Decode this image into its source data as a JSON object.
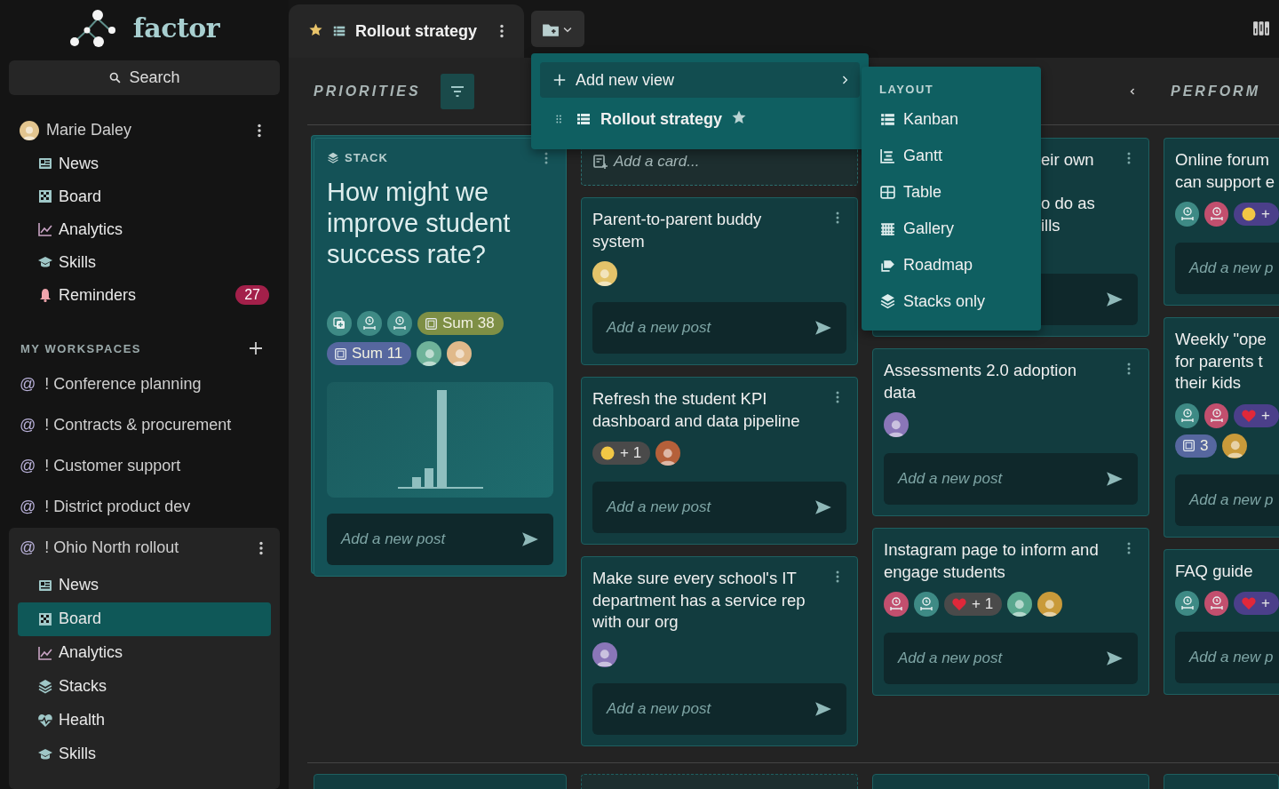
{
  "logo": {
    "text": "factor"
  },
  "search": {
    "placeholder": "Search"
  },
  "user": {
    "name": "Marie Daley",
    "items": [
      {
        "label": "News",
        "selected": false
      },
      {
        "label": "Board",
        "selected": false
      },
      {
        "label": "Analytics",
        "selected": false
      },
      {
        "label": "Skills",
        "selected": false
      },
      {
        "label": "Reminders",
        "selected": false,
        "badge": "27"
      }
    ]
  },
  "workspaces": {
    "title": "MY WORKSPACES",
    "items": [
      {
        "prefix": "@",
        "label": "! Conference planning",
        "expanded": false
      },
      {
        "prefix": "@",
        "label": "! Contracts & procurement",
        "expanded": false
      },
      {
        "prefix": "@",
        "label": "! Customer support",
        "expanded": false
      },
      {
        "prefix": "@",
        "label": "! District product dev",
        "expanded": false
      },
      {
        "prefix": "@",
        "label": "! Ohio North rollout",
        "expanded": true,
        "children": [
          {
            "label": "News",
            "selected": false
          },
          {
            "label": "Board",
            "selected": true
          },
          {
            "label": "Analytics",
            "selected": false
          },
          {
            "label": "Stacks",
            "selected": false
          },
          {
            "label": "Health",
            "selected": false
          },
          {
            "label": "Skills",
            "selected": false
          }
        ]
      }
    ]
  },
  "tab": {
    "title": "Rollout strategy",
    "starred": true
  },
  "board": {
    "groups": [
      {
        "label": "PRIORITIES"
      },
      {
        "label": "PERFORM"
      }
    ],
    "columns": [
      {
        "cards": [
          {
            "kind": "stack",
            "label": "STACK",
            "title": "How might we improve student success rate?",
            "tags": [
              [
                {
                  "kind": "copy",
                  "color": "#3e8a85"
                },
                {
                  "kind": "timer",
                  "color": "#3e8a85"
                },
                {
                  "kind": "timer",
                  "color": "#3e8a85"
                },
                {
                  "kind": "sum",
                  "label": "Sum 38",
                  "color": "#7e8f45"
                }
              ],
              [
                {
                  "kind": "sum",
                  "label": "Sum 11",
                  "color": "#56679f"
                },
                {
                  "kind": "avatar",
                  "color": "#6fb39a"
                },
                {
                  "kind": "avatar",
                  "color": "#e0b98a"
                }
              ]
            ],
            "placeholder": "Add a new post"
          }
        ]
      },
      {
        "cards": [
          {
            "kind": "add",
            "title": "Add a card..."
          },
          {
            "kind": "post",
            "title": "Parent-to-parent buddy system",
            "tags": [
              [
                {
                  "kind": "avatar",
                  "color": "#e3c36a"
                }
              ]
            ],
            "placeholder": "Add a new post"
          },
          {
            "kind": "post",
            "title": "Refresh the student KPI dashboard and data pipeline",
            "tags": [
              [
                {
                  "kind": "face-reaction",
                  "label": "+ 1",
                  "color": "#4a4a4a"
                },
                {
                  "kind": "avatar",
                  "color": "#b5603a"
                }
              ]
            ],
            "placeholder": "Add a new post"
          },
          {
            "kind": "post",
            "title": "Make sure every school's IT department has a service rep with our org",
            "tags": [
              [
                {
                  "kind": "avatar",
                  "color": "#8a76b8"
                }
              ]
            ],
            "placeholder": "Add a new post"
          }
        ]
      },
      {
        "cards": [
          {
            "kind": "partial",
            "fragments": [
              "eir own",
              "o do as",
              "ills"
            ]
          },
          {
            "kind": "post",
            "title": "Assessments 2.0 adoption data",
            "tags": [
              [
                {
                  "kind": "avatar",
                  "color": "#8a76b8"
                }
              ]
            ],
            "placeholder": "Add a new post"
          },
          {
            "kind": "post",
            "title": "Instagram page to inform and engage students",
            "tags": [
              [
                {
                  "kind": "timer",
                  "color": "#c24f6e"
                },
                {
                  "kind": "timer",
                  "color": "#3e8a85"
                },
                {
                  "kind": "heart-reaction",
                  "label": "+ 1",
                  "color": "#4a4a4a"
                },
                {
                  "kind": "avatar",
                  "color": "#5aa88f"
                },
                {
                  "kind": "avatar",
                  "color": "#c99a3a"
                }
              ]
            ],
            "placeholder": "Add a new post"
          }
        ]
      },
      {
        "cards": [
          {
            "kind": "clipped",
            "lines": [
              "Online forum",
              "can support e"
            ],
            "tags": [
              [
                {
                  "kind": "timer",
                  "color": "#3e8a85"
                },
                {
                  "kind": "timer",
                  "color": "#c24f6e"
                },
                {
                  "kind": "face-reaction",
                  "label": "+",
                  "color": "#4b3f8a"
                }
              ]
            ],
            "placeholder": "Add a new p"
          },
          {
            "kind": "clipped",
            "lines": [
              "Weekly \"ope",
              "for parents t",
              "their kids"
            ],
            "tags": [
              [
                {
                  "kind": "timer",
                  "color": "#3e8a85"
                },
                {
                  "kind": "timer",
                  "color": "#c24f6e"
                },
                {
                  "kind": "heart-reaction",
                  "label": "+",
                  "color": "#4b3f8a"
                }
              ],
              [
                {
                  "kind": "sum",
                  "label": "3",
                  "color": "#56679f"
                },
                {
                  "kind": "avatar",
                  "color": "#c99a3a"
                }
              ]
            ],
            "placeholder": "Add a new p"
          },
          {
            "kind": "clipped",
            "lines": [
              "FAQ guide"
            ],
            "tags": [
              [
                {
                  "kind": "timer",
                  "color": "#3e8a85"
                },
                {
                  "kind": "timer",
                  "color": "#c24f6e"
                },
                {
                  "kind": "heart-reaction",
                  "label": "+",
                  "color": "#4b3f8a"
                }
              ]
            ],
            "placeholder": "Add a new p"
          }
        ]
      }
    ]
  },
  "view_menu": {
    "items": [
      {
        "kind": "add",
        "label": "Add new view",
        "selected": true
      },
      {
        "kind": "view",
        "label": "Rollout strategy",
        "selected": false,
        "starred": true
      }
    ]
  },
  "layout_menu": {
    "title": "LAYOUT",
    "items": [
      {
        "label": "Kanban"
      },
      {
        "label": "Gantt"
      },
      {
        "label": "Table"
      },
      {
        "label": "Gallery"
      },
      {
        "label": "Roadmap"
      },
      {
        "label": "Stacks only"
      }
    ]
  }
}
